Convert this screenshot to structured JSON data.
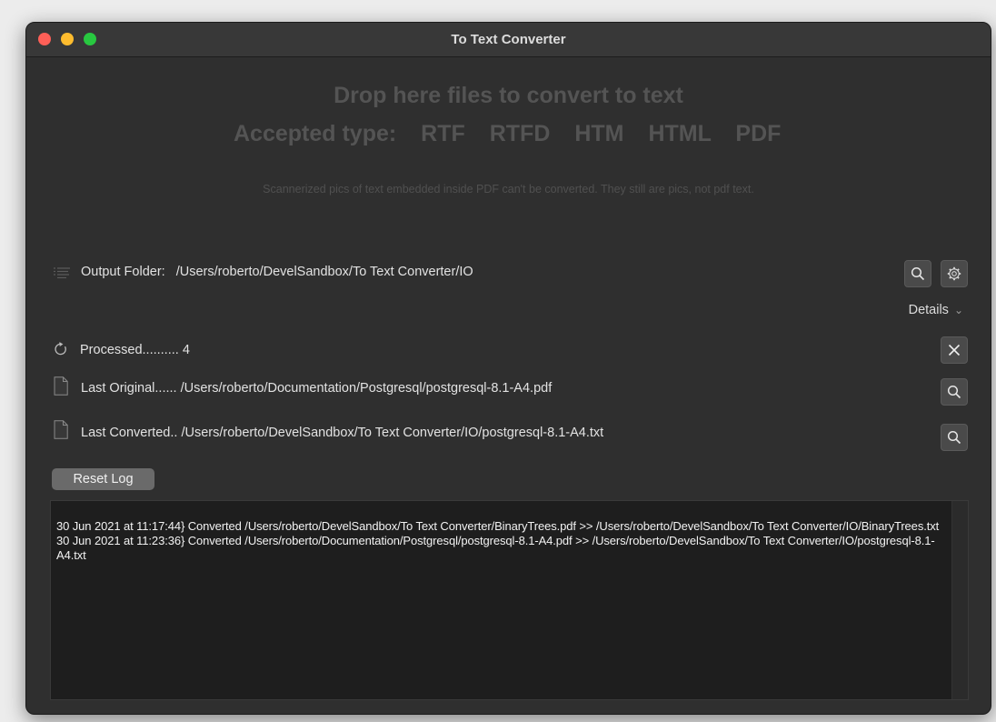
{
  "window": {
    "title": "To Text Converter"
  },
  "drop_zone": {
    "title": "Drop here files to convert to text",
    "accepted_label": "Accepted type:",
    "types": [
      "RTF",
      "RTFD",
      "HTM",
      "HTML",
      "PDF"
    ],
    "note": "Scannerized pics of text embedded inside PDF can't be converted. They still are pics, not pdf text."
  },
  "output": {
    "label": "Output Folder:",
    "path": "/Users/roberto/DevelSandbox/To Text Converter/IO"
  },
  "details": {
    "label": "Details"
  },
  "stats": {
    "processed_label": "Processed..........",
    "processed_count": "4",
    "last_original_label": "Last Original......",
    "last_original_path": "/Users/roberto/Documentation/Postgresql/postgresql-8.1-A4.pdf",
    "last_converted_label": "Last Converted..",
    "last_converted_path": "/Users/roberto/DevelSandbox/To Text Converter/IO/postgresql-8.1-A4.txt"
  },
  "reset_button": "Reset Log",
  "log": [
    "30 Jun 2021 at 11:17:44} Converted /Users/roberto/DevelSandbox/To Text Converter/BinaryTrees.pdf  >>  /Users/roberto/DevelSandbox/To Text Converter/IO/BinaryTrees.txt",
    "30 Jun 2021 at 11:23:36} Converted /Users/roberto/Documentation/Postgresql/postgresql-8.1-A4.pdf  >>  /Users/roberto/DevelSandbox/To Text Converter/IO/postgresql-8.1-A4.txt"
  ],
  "icons": {
    "output_folder": "list-icon",
    "search_output": "search-icon",
    "settings": "gear-icon",
    "processed": "refresh-icon",
    "clear": "close-icon",
    "last_original": "document-icon",
    "search_original": "search-icon",
    "last_converted": "document-icon",
    "search_converted": "search-icon",
    "details_chevron": "chevron-down-icon"
  },
  "colors": {
    "window_bg": "#2f2f2f",
    "titlebar_bg": "#383838",
    "close": "#fe5f57",
    "minimize": "#febc2e",
    "maximize": "#28c840",
    "dim_text": "#545454",
    "text": "#e2e2e2",
    "log_bg": "#1e1e1e"
  }
}
